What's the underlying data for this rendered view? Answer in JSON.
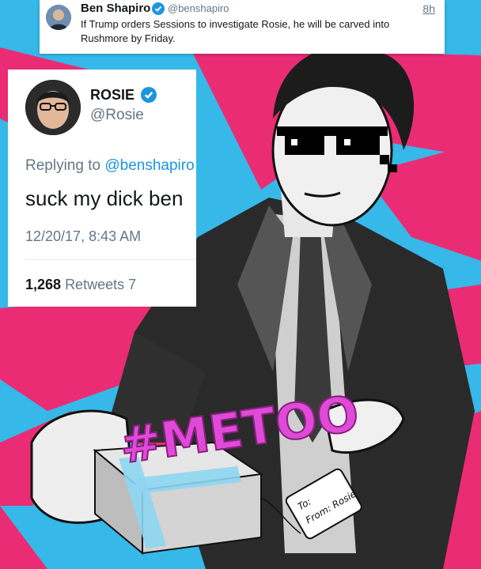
{
  "tweet_top": {
    "name": "Ben Shapiro",
    "handle": "@benshapiro",
    "time": "8h",
    "text": "If Trump orders Sessions to investigate Rosie, he will be carved into Rushmore by Friday."
  },
  "tweet_main": {
    "name": "ROSIE",
    "handle": "@Rosie",
    "replying_prefix": "Replying to",
    "replying_handle": "@benshapiro",
    "body": "suck my dick ben",
    "date": "12/20/17, 8:43 AM",
    "retweet_count": "1,268",
    "retweet_label": "Retweets",
    "stat_fragment": "7"
  },
  "illustration": {
    "hashtag": "#METOO",
    "tag_line1": "To:",
    "tag_line2": "From: Rosie"
  },
  "colors": {
    "pink": "#ea2c74",
    "blue": "#36b8e8",
    "magenta": "#e04ad8",
    "twitter_blue": "#1b95e0"
  }
}
